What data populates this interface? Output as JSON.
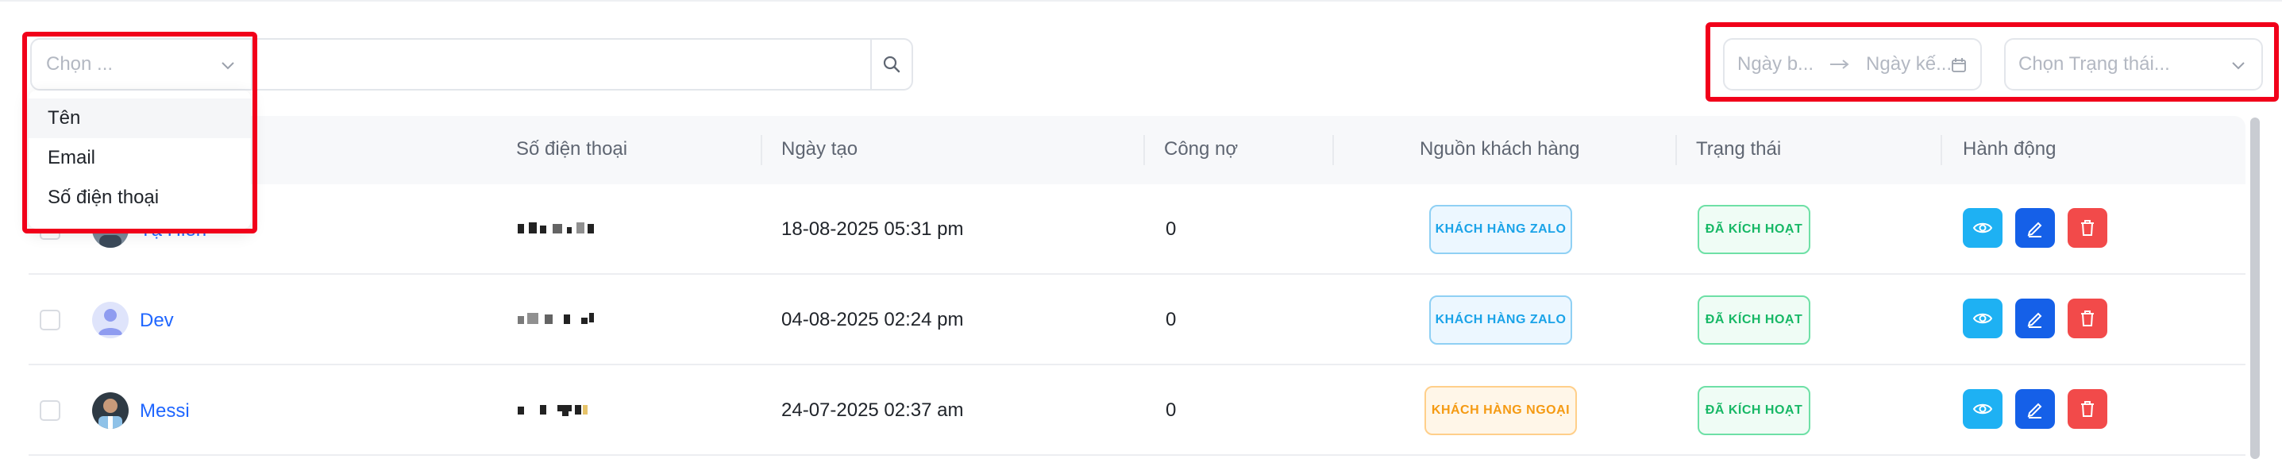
{
  "filters": {
    "search_field_placeholder": "Chọn ...",
    "date_start_placeholder": "Ngày b...",
    "date_end_placeholder": "Ngày kế...",
    "status_placeholder": "Chọn Trạng thái..."
  },
  "search_field_options": [
    "Tên",
    "Email",
    "Số điện thoại"
  ],
  "table": {
    "headers": [
      "Số điện thoại",
      "Ngày tạo",
      "Công nợ",
      "Nguồn khách hàng",
      "Trạng thái",
      "Hành động"
    ],
    "rows": [
      {
        "name": "Tạ Hiên",
        "created": "18-08-2025 05:31 pm",
        "debt": "0",
        "source": "KHÁCH HÀNG ZALO",
        "status": "ĐÃ KÍCH HOẠT"
      },
      {
        "name": "Dev",
        "created": "04-08-2025 02:24 pm",
        "debt": "0",
        "source": "KHÁCH HÀNG ZALO",
        "status": "ĐÃ KÍCH HOẠT"
      },
      {
        "name": "Messi",
        "created": "24-07-2025 02:37 am",
        "debt": "0",
        "source": "KHÁCH HÀNG NGOẠI",
        "status": "ĐÃ KÍCH HOẠT"
      }
    ]
  },
  "colors": {
    "highlight": "#f1001a",
    "link": "#1f66ff",
    "view_button": "#1eb1f3",
    "edit_button": "#1560e8",
    "delete_button": "#f24a4a"
  }
}
